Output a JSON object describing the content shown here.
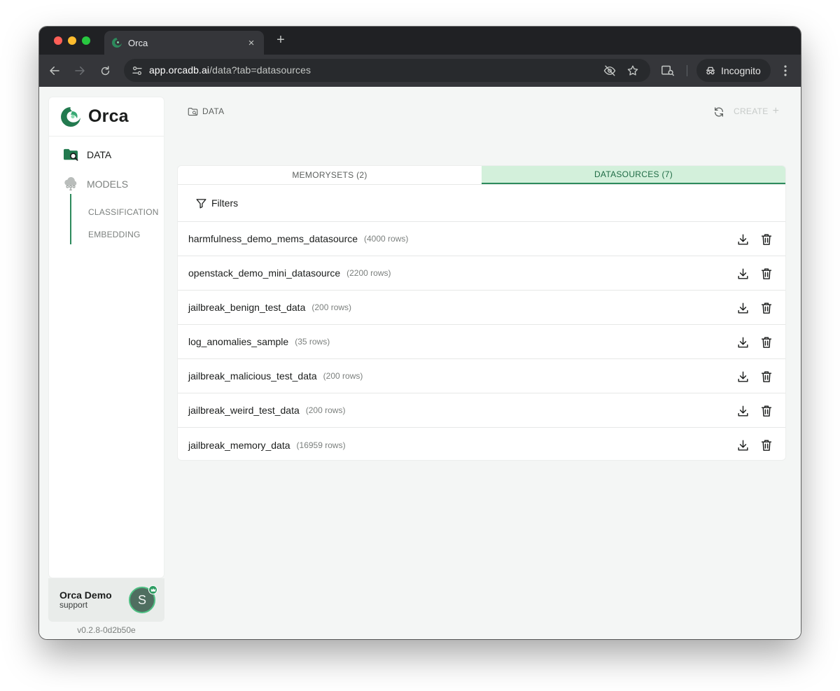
{
  "browser": {
    "tab_title": "Orca",
    "tab_close": "×",
    "new_tab": "+",
    "url_host": "app.orcadb.ai",
    "url_path": "/data?tab=datasources",
    "incognito_label": "Incognito"
  },
  "sidebar": {
    "brand": "Orca",
    "nav": {
      "data": "DATA",
      "models": "MODELS"
    },
    "sub_items": {
      "classification": "CLASSIFICATION",
      "embedding": "EMBEDDING"
    },
    "user": {
      "name": "Orca Demo",
      "role": "support",
      "avatar_letter": "S"
    },
    "version": "v0.2.8-0d2b50e"
  },
  "header": {
    "breadcrumb": "DATA",
    "create_label": "CREATE",
    "create_plus": "+"
  },
  "tabs": {
    "memorysets": "MEMORYSETS (2)",
    "datasources": "DATASOURCES (7)"
  },
  "filters_label": "Filters",
  "rows": [
    {
      "name": "harmfulness_demo_mems_datasource",
      "count": "(4000 rows)"
    },
    {
      "name": "openstack_demo_mini_datasource",
      "count": "(2200 rows)"
    },
    {
      "name": "jailbreak_benign_test_data",
      "count": "(200 rows)"
    },
    {
      "name": "log_anomalies_sample",
      "count": "(35 rows)"
    },
    {
      "name": "jailbreak_malicious_test_data",
      "count": "(200 rows)"
    },
    {
      "name": "jailbreak_weird_test_data",
      "count": "(200 rows)"
    },
    {
      "name": "jailbreak_memory_data",
      "count": "(16959 rows)"
    }
  ],
  "colors": {
    "accent": "#2d8a5c",
    "active_tab_bg": "#d3f0db",
    "active_tab_text": "#1f6b45"
  }
}
